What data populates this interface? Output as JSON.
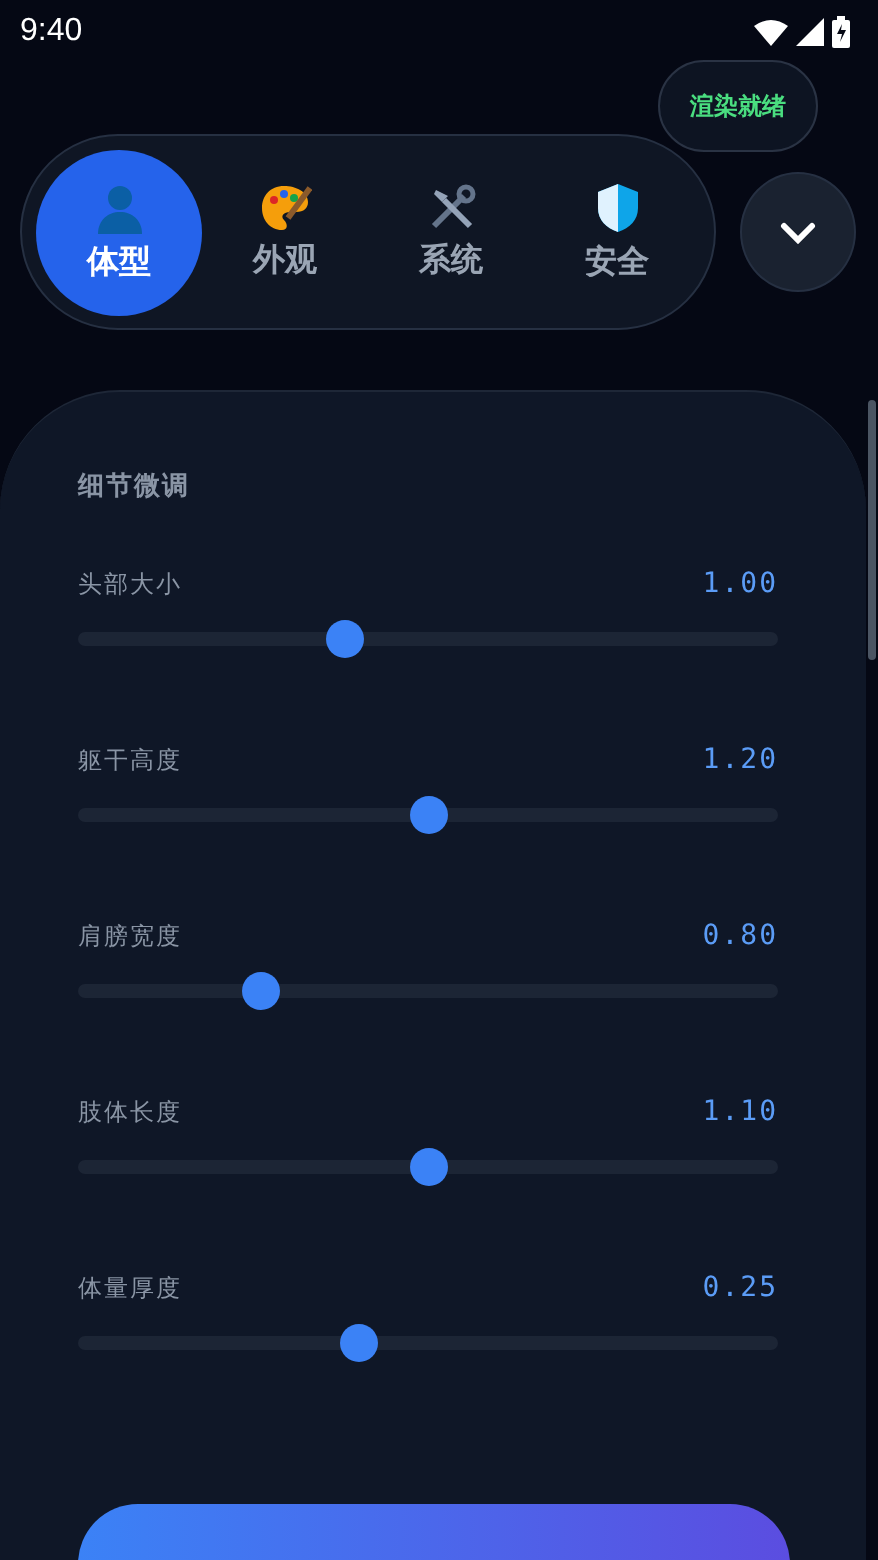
{
  "status_bar": {
    "time": "9:40"
  },
  "status_badge": "渲染就绪",
  "tabs": [
    {
      "label": "体型",
      "selected": true
    },
    {
      "label": "外观",
      "selected": false
    },
    {
      "label": "系统",
      "selected": false
    },
    {
      "label": "安全",
      "selected": false
    }
  ],
  "section_title": "细节微调",
  "sliders": [
    {
      "label": "头部大小",
      "reading": "1.00",
      "level": 0.38
    },
    {
      "label": "躯干高度",
      "reading": "1.20",
      "level": 0.5
    },
    {
      "label": "肩膀宽度",
      "reading": "0.80",
      "level": 0.26
    },
    {
      "label": "肢体长度",
      "reading": "1.10",
      "level": 0.5
    },
    {
      "label": "体量厚度",
      "reading": "0.25",
      "level": 0.4
    }
  ]
}
